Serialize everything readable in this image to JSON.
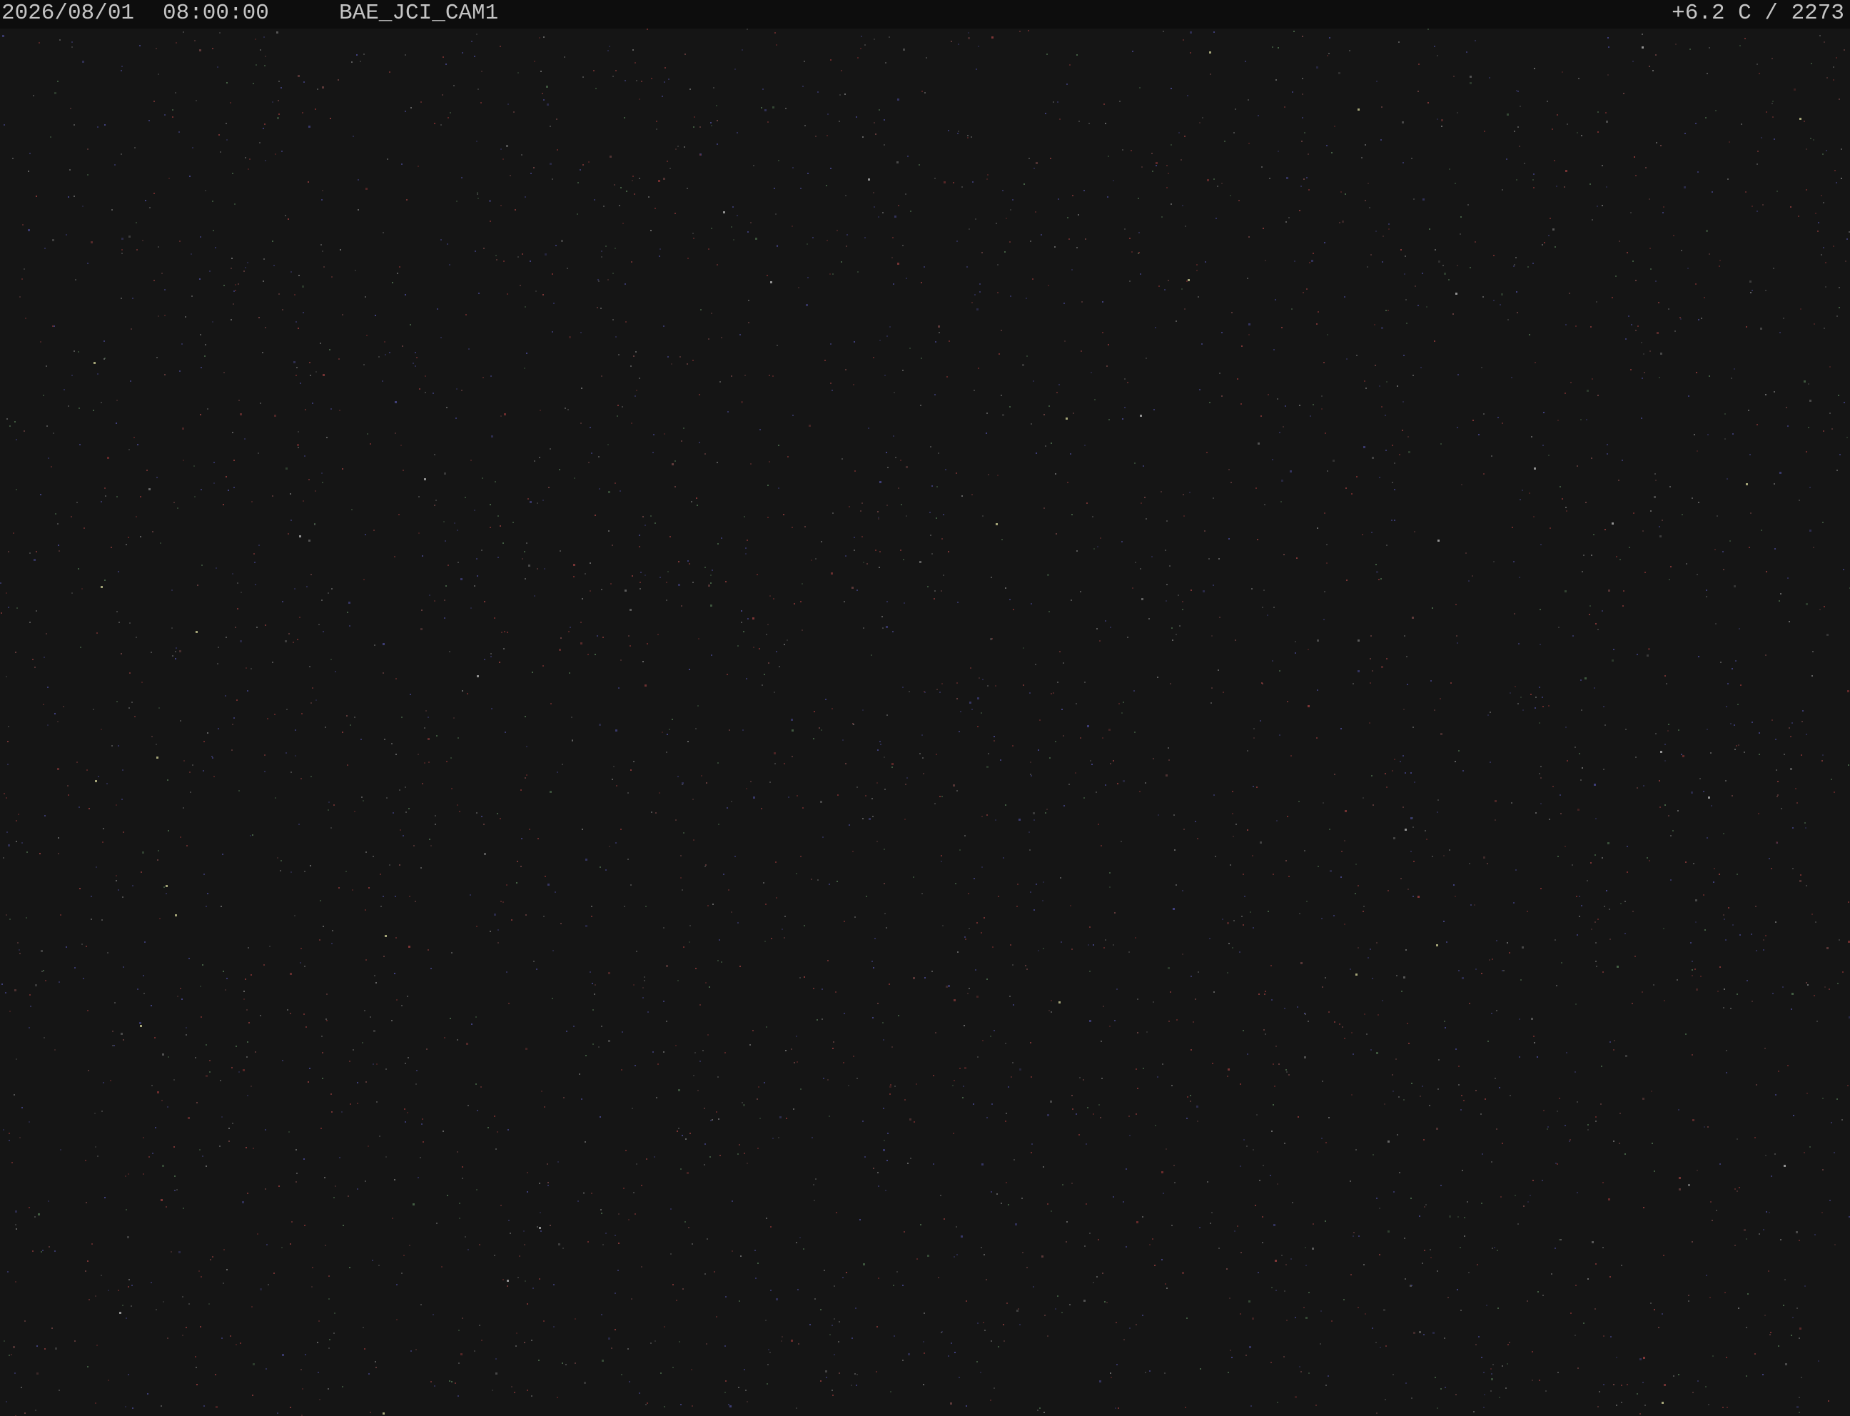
{
  "overlay": {
    "date": "2026/08/01",
    "time": "08:00:00",
    "camera_id": "BAE_JCI_CAM1",
    "temperature_reading": "+6.2 C / 2273"
  },
  "colors": {
    "sky_background": "#151515",
    "overlay_bar": "#0d0d0d",
    "overlay_text": "#c4c4c4"
  }
}
